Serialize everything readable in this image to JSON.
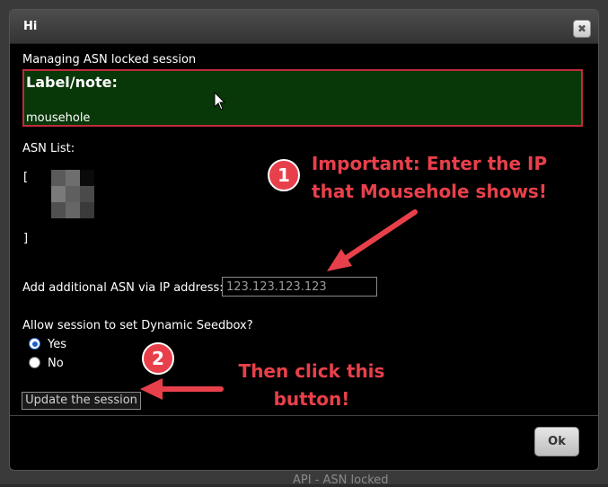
{
  "dialog": {
    "title": "Hi",
    "close_glyph": "✖",
    "heading": "Managing ASN locked session",
    "label_title": "Label/note:",
    "label_value": "mousehole",
    "asn_list_label": "ASN List:",
    "asn_open": "[",
    "asn_close": "]",
    "ip_label": "Add additional ASN via IP address:",
    "ip_value": "123.123.123.123",
    "seedbox_question": "Allow session to set Dynamic Seedbox?",
    "yes_label": "Yes",
    "no_label": "No",
    "selected": "Yes",
    "update_label": "Update the session",
    "ok_label": "Ok"
  },
  "annotations": {
    "badge1": "1",
    "badge2": "2",
    "note1_line1": "Important: Enter the IP",
    "note1_line2": "that Mousehole shows!",
    "note2_line1": "Then click this",
    "note2_line2": "button!"
  },
  "background": {
    "peek_text": "API - ASN locked"
  },
  "colors": {
    "annotation_red": "#e8404b",
    "label_box_bg": "#083708",
    "label_box_border": "#c22a3a"
  },
  "icons": {
    "close": "close-icon",
    "cursor": "mouse-cursor-icon"
  }
}
